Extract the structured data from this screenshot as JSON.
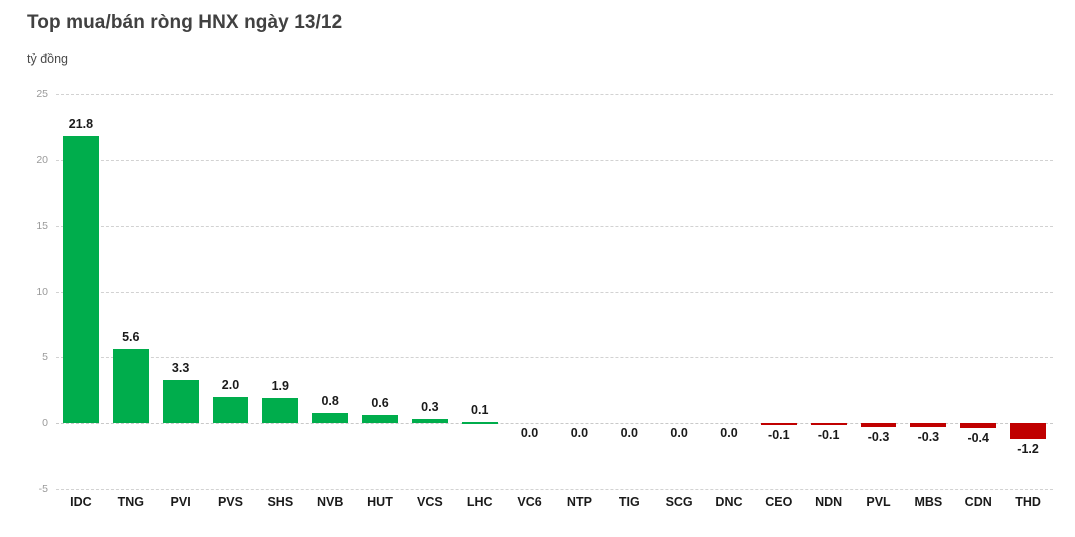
{
  "chart_data": {
    "type": "bar",
    "title": "Top mua/bán ròng HNX ngày 13/12",
    "subtitle": "",
    "xlabel": "",
    "ylabel": "tỷ đồng",
    "ylim": [
      -5,
      25
    ],
    "ytick_values": [
      25,
      20,
      15,
      10,
      5,
      0,
      -5
    ],
    "ytick_labels": [
      "25",
      "20",
      "15",
      "10",
      "5",
      "0",
      "-5"
    ],
    "grid": true,
    "legend": false,
    "legend_position": "none",
    "value_label_format": "0.0",
    "positive_color": "#00AD4C",
    "negative_color": "#C00000",
    "categories": [
      "IDC",
      "TNG",
      "PVI",
      "PVS",
      "SHS",
      "NVB",
      "HUT",
      "VCS",
      "LHC",
      "VC6",
      "NTP",
      "TIG",
      "SCG",
      "DNC",
      "CEO",
      "NDN",
      "PVL",
      "MBS",
      "CDN",
      "THD"
    ],
    "values": [
      21.8,
      5.6,
      3.3,
      2.0,
      1.9,
      0.8,
      0.6,
      0.3,
      0.1,
      0.0,
      0.0,
      0.0,
      0.0,
      0.0,
      -0.1,
      -0.1,
      -0.3,
      -0.3,
      -0.4,
      -1.2
    ],
    "value_labels": [
      "21.8",
      "5.6",
      "3.3",
      "2.0",
      "1.9",
      "0.8",
      "0.6",
      "0.3",
      "0.1",
      "0.0",
      "0.0",
      "0.0",
      "0.0",
      "0.0",
      "-0.1",
      "-0.1",
      "-0.3",
      "-0.3",
      "-0.4",
      "-1.2"
    ]
  }
}
